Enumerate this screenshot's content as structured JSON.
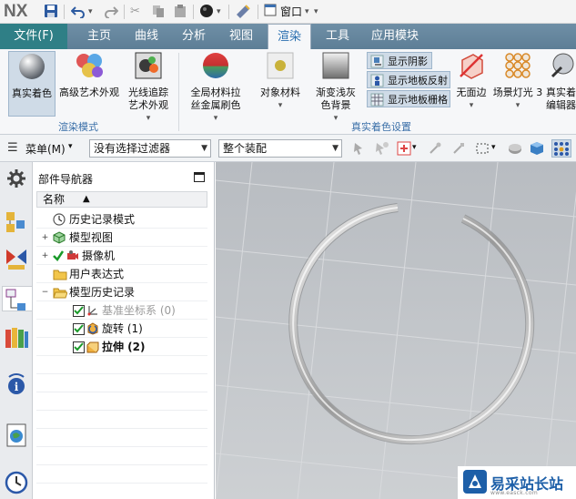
{
  "app": {
    "logo": "NX"
  },
  "quick_access": {
    "window_label": "窗口"
  },
  "tabs": {
    "file": "文件(F)",
    "items": [
      "主页",
      "曲线",
      "分析",
      "视图",
      "渲染",
      "工具",
      "应用模块"
    ],
    "active": "渲染"
  },
  "ribbon": {
    "real_shading": "真实着色",
    "advanced_art": "高级艺术外观",
    "raytrace_line1": "光线追踪",
    "raytrace_line2": "艺术外观",
    "global_material_line1": "全局材料拉",
    "global_material_line2": "丝金属刷色",
    "object_material": "对象材料",
    "gradient_line1": "渐变浅灰",
    "gradient_line2": "色背景",
    "show_shadow": "显示阴影",
    "show_floor_reflection": "显示地板反射",
    "show_floor_grid": "显示地板栅格",
    "no_face_edges": "无面边",
    "scene_light": "场景灯光 3",
    "real_shading_editor_line1": "真实着",
    "real_shading_editor_line2": "编辑器",
    "group_render_mode": "渲染模式",
    "group_real_shading_settings": "真实着色设置"
  },
  "selection_bar": {
    "menu_label": "菜单(M)",
    "filter_value": "没有选择过滤器",
    "assembly_scope": "整个装配"
  },
  "navigator": {
    "title": "部件导航器",
    "column_name": "名称",
    "items": [
      {
        "label": "历史记录模式",
        "bold": false,
        "dim": false
      },
      {
        "label": "模型视图",
        "bold": false,
        "dim": false
      },
      {
        "label": "摄像机",
        "bold": false,
        "dim": false
      },
      {
        "label": "用户表达式",
        "bold": false,
        "dim": false
      },
      {
        "label": "模型历史记录",
        "bold": false,
        "dim": false
      },
      {
        "label": "基准坐标系 (0)",
        "bold": false,
        "dim": true
      },
      {
        "label": "旋转 (1)",
        "bold": false,
        "dim": false
      },
      {
        "label": "拉伸 (2)",
        "bold": true,
        "dim": false
      }
    ]
  },
  "watermark": {
    "text": "易采站长站",
    "sub": "www.easck.com"
  },
  "colors": {
    "ribbon_tab_bar": "#6f8fa6",
    "file_tab": "#2f7f86",
    "active_tab_text": "#2a6fb0",
    "group_label": "#3a6fa8",
    "viewport_bg": "#c4c8cc",
    "check_green": "#1a9a2a"
  }
}
